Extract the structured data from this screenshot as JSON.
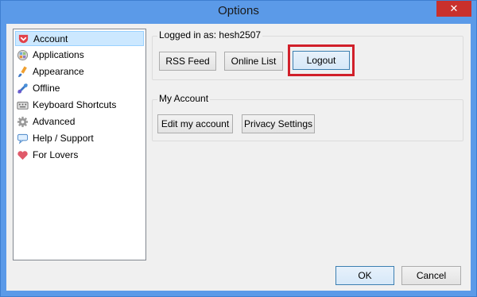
{
  "window": {
    "title": "Options",
    "close_label": "✕"
  },
  "sidebar": {
    "items": [
      {
        "label": "Account",
        "icon": "pocket-icon"
      },
      {
        "label": "Applications",
        "icon": "applications-icon"
      },
      {
        "label": "Appearance",
        "icon": "paint-brush-icon"
      },
      {
        "label": "Offline",
        "icon": "offline-icon"
      },
      {
        "label": "Keyboard Shortcuts",
        "icon": "keyboard-icon"
      },
      {
        "label": "Advanced",
        "icon": "gear-icon"
      },
      {
        "label": "Help / Support",
        "icon": "speech-bubble-icon"
      },
      {
        "label": "For Lovers",
        "icon": "heart-icon"
      }
    ],
    "selected": "Account"
  },
  "account_group": {
    "label": "Logged in as: hesh2507",
    "buttons": {
      "rss_feed": "RSS Feed",
      "online_list": "Online List",
      "logout": "Logout"
    }
  },
  "my_account_group": {
    "label": "My Account",
    "buttons": {
      "edit_account": "Edit my account",
      "privacy_settings": "Privacy Settings"
    }
  },
  "footer": {
    "ok": "OK",
    "cancel": "Cancel"
  },
  "colors": {
    "titlebar": "#5b9ae8",
    "close": "#c9302c",
    "highlight": "#d1202a",
    "selection": "#cce8ff"
  }
}
